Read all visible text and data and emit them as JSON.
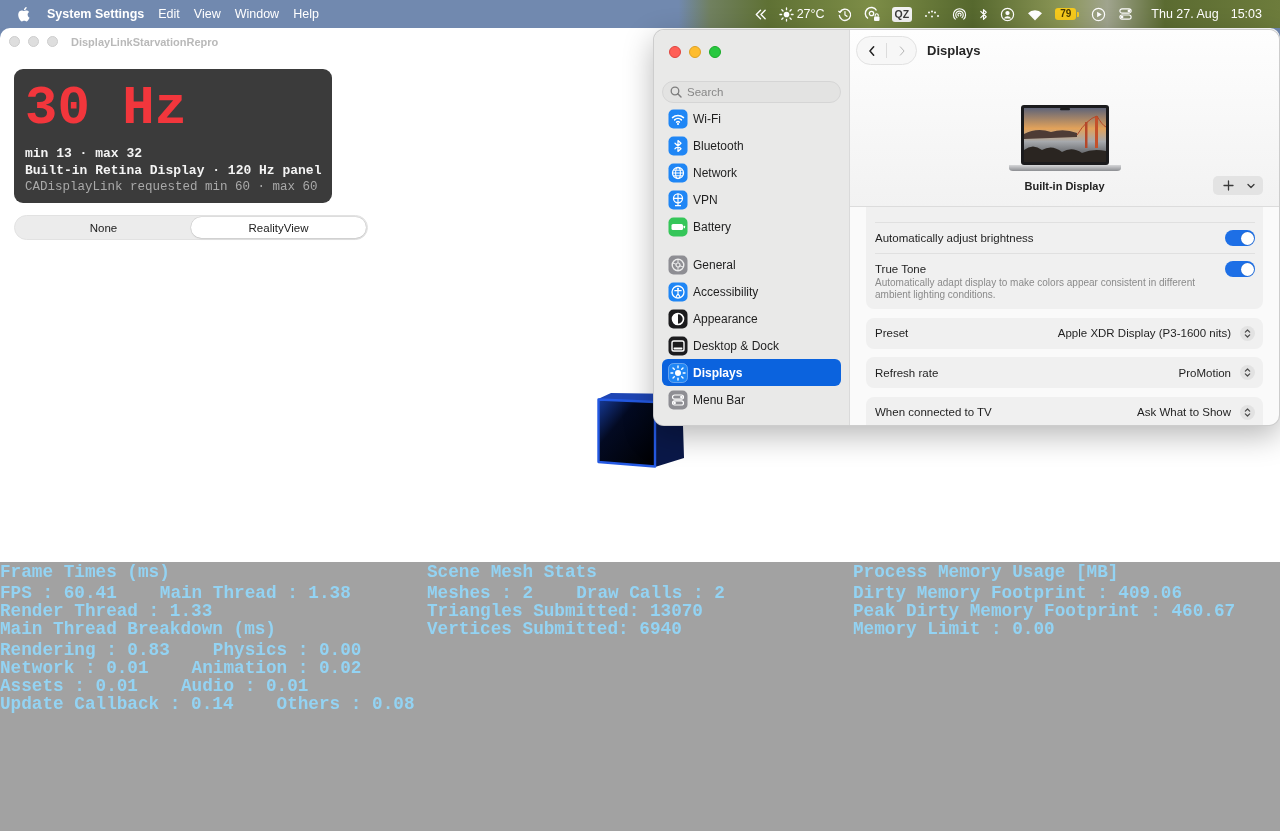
{
  "menu_bar": {
    "app_name": "System Settings",
    "menus": [
      "Edit",
      "View",
      "Window",
      "Help"
    ],
    "weather": "27°C",
    "input_source": "QZ",
    "battery": "79",
    "date": "Thu 27. Aug",
    "time": "15:03"
  },
  "app_window": {
    "title": "DisplayLinkStarvationRepro",
    "active": false,
    "rate_card": {
      "rate": "30 Hz",
      "range": "min 13 · max 32",
      "display": "Built-in Retina Display · 120 Hz panel",
      "requested": "CADisplayLink requested min 60 · max 60"
    },
    "segments": [
      {
        "label": "None",
        "selected": false
      },
      {
        "label": "RealityView",
        "selected": true
      }
    ],
    "stats": {
      "columns": [
        {
          "lines": [
            {
              "kind": "heading",
              "items": [
                "Frame Times (ms)"
              ]
            },
            {
              "kind": "values",
              "items": [
                "FPS : 60.41",
                "Main Thread : 1.38"
              ]
            },
            {
              "kind": "values",
              "items": [
                "Render Thread : 1.33"
              ]
            },
            {
              "kind": "heading",
              "items": [
                "Main Thread Breakdown (ms)"
              ]
            },
            {
              "kind": "values",
              "items": [
                "Rendering : 0.83",
                "Physics : 0.00"
              ]
            },
            {
              "kind": "values",
              "items": [
                "Network : 0.01",
                "Animation : 0.02"
              ]
            },
            {
              "kind": "values",
              "items": [
                "Assets : 0.01",
                "Audio : 0.01"
              ]
            },
            {
              "kind": "values",
              "items": [
                "Update Callback : 0.14",
                "Others : 0.08"
              ]
            }
          ]
        },
        {
          "lines": [
            {
              "kind": "heading",
              "items": [
                "Scene Mesh Stats"
              ]
            },
            {
              "kind": "values",
              "items": [
                "Meshes : 2",
                "Draw Calls : 2"
              ]
            },
            {
              "kind": "values",
              "items": [
                "Triangles Submitted: 13070"
              ]
            },
            {
              "kind": "values",
              "items": [
                "Vertices Submitted: 6940"
              ]
            }
          ]
        },
        {
          "lines": [
            {
              "kind": "heading",
              "items": [
                "Process Memory Usage [MB]"
              ]
            },
            {
              "kind": "values",
              "items": [
                "Dirty Memory Footprint : 409.06"
              ]
            },
            {
              "kind": "values",
              "items": [
                "Peak Dirty Memory Footprint : 460.67"
              ]
            },
            {
              "kind": "values",
              "items": [
                "Memory Limit : 0.00"
              ]
            }
          ]
        }
      ]
    }
  },
  "settings_window": {
    "active": true,
    "sidebar": {
      "search": {
        "placeholder": "Search"
      },
      "sections": [
        {
          "items": [
            {
              "label": "Wi-Fi",
              "color": "#1f86f5",
              "selected": false
            },
            {
              "label": "Bluetooth",
              "color": "#1f86f5",
              "selected": false
            },
            {
              "label": "Network",
              "color": "#1f86f5",
              "selected": false
            },
            {
              "label": "VPN",
              "color": "#1f86f5",
              "selected": false
            },
            {
              "label": "Battery",
              "color": "#35c659",
              "selected": false
            }
          ]
        },
        {
          "items": [
            {
              "label": "General",
              "color": "#8e8e93",
              "selected": false
            },
            {
              "label": "Accessibility",
              "color": "#1f86f5",
              "selected": false
            },
            {
              "label": "Appearance",
              "color": "#1c1c1e",
              "selected": false
            },
            {
              "label": "Desktop & Dock",
              "color": "#1c1c1e",
              "selected": false
            },
            {
              "label": "Displays",
              "color": "#1f86f5",
              "selected": true
            },
            {
              "label": "Menu Bar",
              "color": "#8e8e93",
              "selected": false
            }
          ]
        }
      ]
    },
    "navigation": [
      {
        "kind": "back",
        "disabled": false
      },
      {
        "kind": "forward",
        "disabled": true
      }
    ],
    "title": "Displays",
    "display_name": "Built-in Display",
    "cards": [
      {
        "rows": [
          {
            "kind": "toggle",
            "label": "Automatically adjust brightness",
            "on": true
          },
          {
            "kind": "toggle",
            "label": "True Tone",
            "description": "Automatically adapt display to make colors appear consistent in different ambient lighting conditions.",
            "on": true
          }
        ]
      },
      {
        "rows": [
          {
            "kind": "popup",
            "label": "Preset",
            "value": "Apple XDR Display (P3-1600 nits)"
          }
        ]
      },
      {
        "rows": [
          {
            "kind": "popup",
            "label": "Refresh rate",
            "value": "ProMotion"
          }
        ]
      },
      {
        "rows": [
          {
            "kind": "popup",
            "label": "When connected to TV",
            "value": "Ask What to Show"
          }
        ]
      }
    ]
  }
}
